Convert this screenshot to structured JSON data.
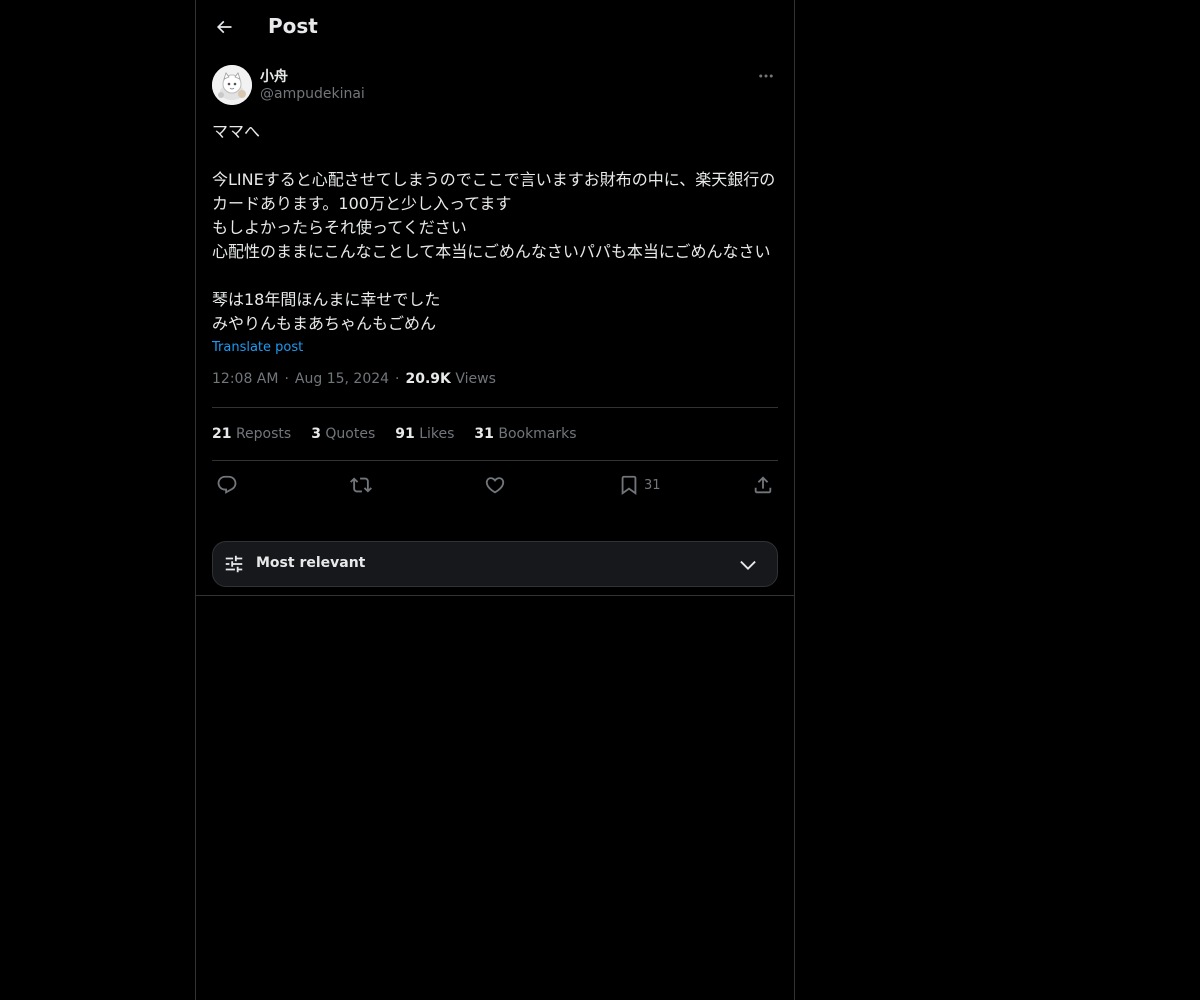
{
  "header": {
    "title": "Post",
    "back_icon": "arrow-left-icon"
  },
  "post": {
    "author": {
      "display_name": "小舟",
      "handle": "@ampudekinai"
    },
    "text": "ママへ\n\n今LINEすると心配させてしまうのでここで言いますお財布の中に、楽天銀行のカードあります。100万と少し入ってます\nもしよかったらそれ使ってください\n心配性のままにこんなことして本当にごめんなさいパパも本当にごめんなさい\n\n琴は18年間ほんまに幸せでした\nみやりんもまあちゃんもごめん",
    "translate_label": "Translate post",
    "time": "12:08 AM",
    "date": "Aug 15, 2024",
    "views_count": "20.9K",
    "views_label": "Views",
    "separator": "·"
  },
  "stats": {
    "reposts": {
      "count": "21",
      "label": "Reposts"
    },
    "quotes": {
      "count": "3",
      "label": "Quotes"
    },
    "likes": {
      "count": "91",
      "label": "Likes"
    },
    "bookmarks": {
      "count": "31",
      "label": "Bookmarks"
    }
  },
  "actions": {
    "bookmark_count": "31",
    "icons": [
      "reply-icon",
      "repost-icon",
      "like-icon",
      "bookmark-icon",
      "share-icon"
    ]
  },
  "sort": {
    "label": "Most relevant",
    "icon": "sliders-icon",
    "chevron": "chevron-down-icon"
  },
  "colors": {
    "background": "#000000",
    "text": "#e7e9ea",
    "muted": "#71767b",
    "link": "#1d9bf0",
    "border": "#2f3336"
  }
}
